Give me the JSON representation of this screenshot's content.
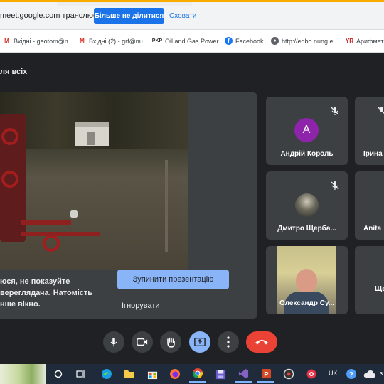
{
  "share_bar": {
    "message": "meet.google.com транслює вікно.",
    "stop_label": "Більше не ділитися",
    "hide_label": "Сховати"
  },
  "bookmarks": [
    {
      "icon": "gmail-icon",
      "label": "Вхідні - geotom@n..."
    },
    {
      "icon": "gmail-icon",
      "label": "Вхідні (2) - grf@nu..."
    },
    {
      "icon": "pkr-icon",
      "label": "Oil and Gas Power..."
    },
    {
      "icon": "facebook-icon",
      "label": "Facebook"
    },
    {
      "icon": "globe-icon",
      "label": "http://edbo.nung.e..."
    },
    {
      "icon": "yr-icon",
      "label": "Арифмет"
    }
  ],
  "bookmark_icon_glyphs": {
    "gmail": "M",
    "pkr": "PKP",
    "facebook": "f",
    "globe": "●",
    "yr": "YR"
  },
  "meeting": {
    "header_title": "ля всіх"
  },
  "presentation": {
    "message_lines": [
      "юся, не показуйте",
      "вереглядача. Натомість",
      "нше вікно."
    ],
    "stop_presentation_label": "Зупинити презентацію",
    "ignore_label": "Ігнорувати"
  },
  "participants": [
    {
      "name": "Андрій Король",
      "avatar_letter": "А",
      "avatar_color": "#8e24aa",
      "muted": true
    },
    {
      "name": "Ірина",
      "muted": false
    },
    {
      "name": "Дмитро Щерба...",
      "muted": true
    },
    {
      "name": "Anita",
      "muted": false
    },
    {
      "name": "Олександр Су...",
      "muted": false
    },
    {
      "name": "Ще",
      "muted": false
    }
  ],
  "controls": [
    {
      "icon": "mic-icon"
    },
    {
      "icon": "camera-icon"
    },
    {
      "icon": "raise-hand-icon"
    },
    {
      "icon": "present-screen-icon"
    },
    {
      "icon": "more-options-icon"
    },
    {
      "icon": "end-call-icon"
    }
  ],
  "taskbar": {
    "language": "UK",
    "clock_fragment": "з"
  },
  "colors": {
    "meet_background": "#202124",
    "tile_background": "#3c4043",
    "accent_blue": "#1a73e8",
    "present_blue": "#8ab4f8",
    "end_call_red": "#ea4335"
  }
}
